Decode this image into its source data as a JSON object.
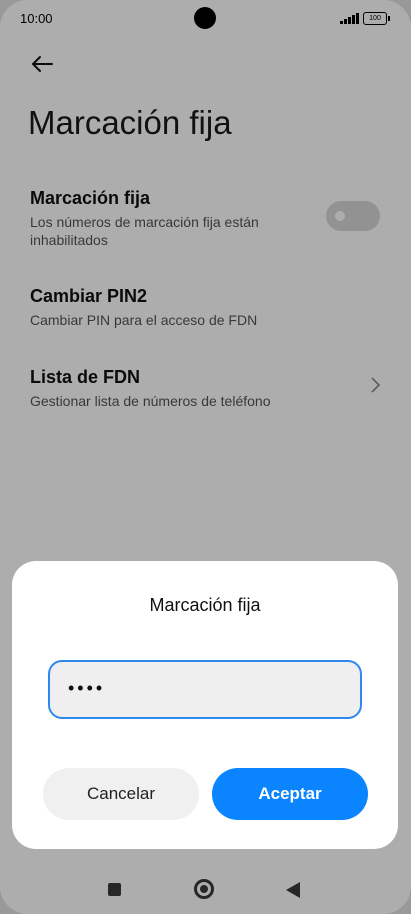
{
  "status_bar": {
    "time": "10:00",
    "battery": "100"
  },
  "page": {
    "title": "Marcación fija"
  },
  "settings": [
    {
      "title": "Marcación fija",
      "subtitle": "Los números de marcación fija están inhabilitados",
      "toggle_on": false
    },
    {
      "title": "Cambiar PIN2",
      "subtitle": "Cambiar PIN para el acceso de FDN"
    },
    {
      "title": "Lista de FDN",
      "subtitle": "Gestionar lista de números de teléfono"
    }
  ],
  "dialog": {
    "title": "Marcación fija",
    "pin_value": "••••",
    "cancel_label": "Cancelar",
    "ok_label": "Aceptar"
  },
  "colors": {
    "accent": "#0a84ff",
    "field_border": "#2f87f0"
  }
}
